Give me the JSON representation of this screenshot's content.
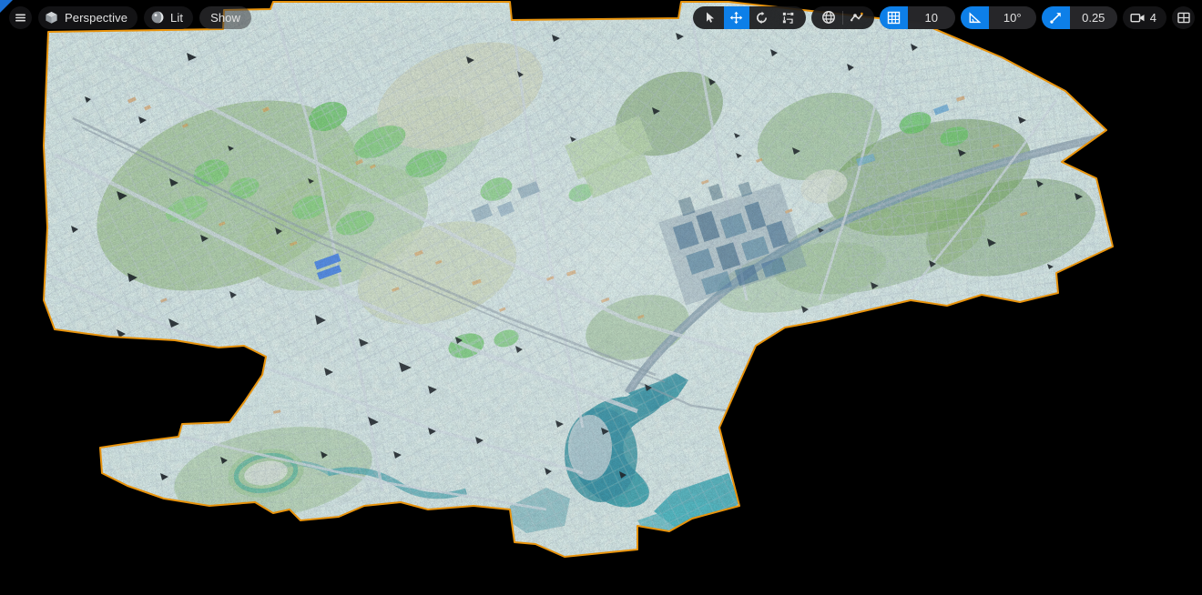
{
  "app": {
    "context": "level-viewport",
    "background_color": "#000000"
  },
  "viewport": {
    "focus_marker_color": "#1a6fd4",
    "selection_outline_color": "#e8930c",
    "scene_description": "Aerial photogrammetry city mesh (Melbourne) selected in viewport"
  },
  "toolbar_left": {
    "menu": {
      "icon": "hamburger-menu-icon",
      "label": ""
    },
    "view_mode": {
      "icon": "cube-icon",
      "label": "Perspective"
    },
    "lighting_mode": {
      "icon": "sphere-lit-icon",
      "label": "Lit"
    },
    "show": {
      "label": "Show"
    }
  },
  "toolbar_right": {
    "transform_tools": [
      {
        "name": "select-tool",
        "icon": "cursor-arrow-icon",
        "active": false
      },
      {
        "name": "move-tool",
        "icon": "move-arrows-icon",
        "active": true
      },
      {
        "name": "rotate-tool",
        "icon": "rotate-arrows-icon",
        "active": false
      },
      {
        "name": "scale-tool",
        "icon": "scale-icon",
        "active": false
      }
    ],
    "coordinate_system": {
      "name": "world-coordinate-toggle",
      "icon": "globe-icon",
      "active": false
    },
    "surface_snap": {
      "name": "surface-snap-toggle",
      "icon": "surface-snap-icon",
      "active": false
    },
    "grid_snap": {
      "icon": "grid-icon",
      "active": true,
      "value": "10"
    },
    "angle_snap": {
      "icon": "angle-icon",
      "active": true,
      "value": "10°"
    },
    "scale_snap": {
      "icon": "scale-snap-arrow-icon",
      "active": true,
      "value": "0.25"
    },
    "camera_speed": {
      "icon": "camera-icon",
      "value": "4"
    },
    "layout": {
      "icon": "viewport-layout-icon"
    }
  }
}
